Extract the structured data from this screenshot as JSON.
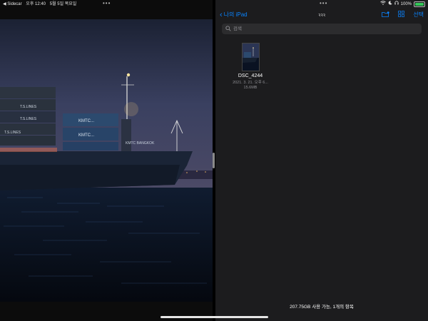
{
  "status_bar": {
    "back_app": "◀ Sidecar",
    "time": "오후 12:40",
    "date": "5월 5일 목요일",
    "battery": "100%"
  },
  "left_pane": {
    "menu_dots": "•••"
  },
  "files": {
    "menu_dots": "•••",
    "back_label": "나의 iPad",
    "sort_glyph": "ꝛꝛꝛ",
    "select_label": "선택",
    "search_placeholder": "검색",
    "items": [
      {
        "name": "DSC_4244",
        "date": "2021. 3. 21. 오후 6...",
        "size": "15.6MB"
      }
    ],
    "footer": "207.75GB 사용 가능, 1개의 항목"
  },
  "colors": {
    "accent": "#0a84ff",
    "panel": "#1c1c1e",
    "battery": "#34c759"
  }
}
